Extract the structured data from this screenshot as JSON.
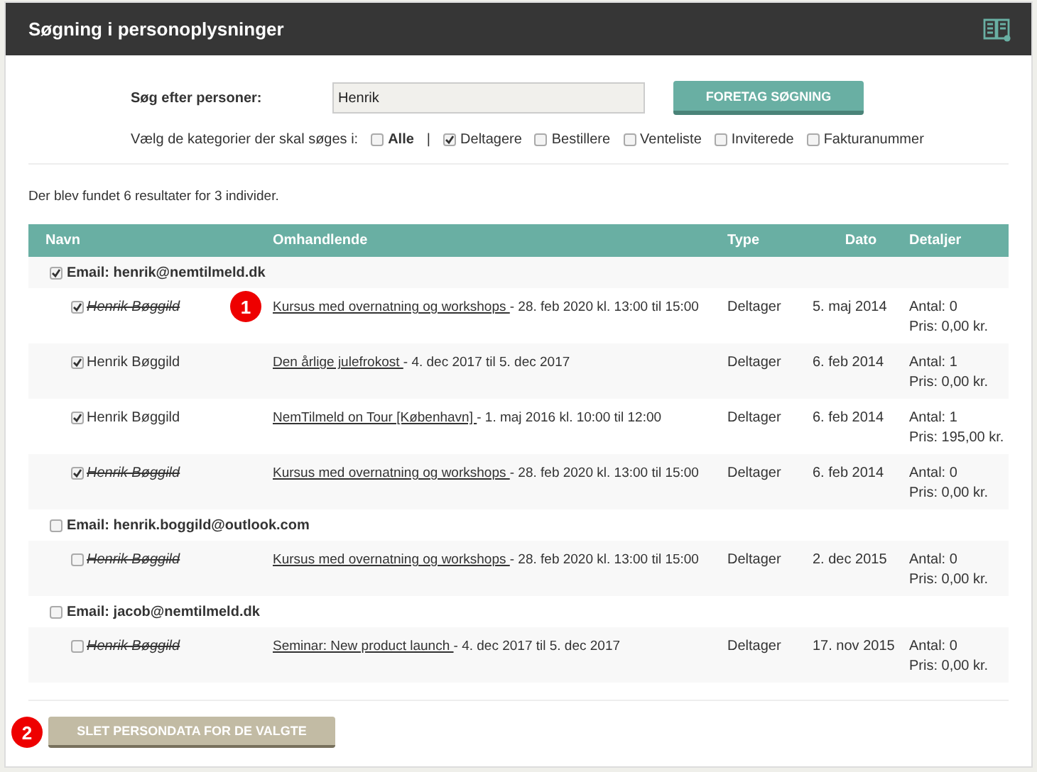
{
  "header": {
    "title": "Søgning i personoplysninger"
  },
  "search": {
    "label": "Søg efter personer:",
    "value": "Henrik",
    "button": "FORETAG SØGNING"
  },
  "categories": {
    "label": "Vælg de kategorier der skal søges i:",
    "separator": "|",
    "items": [
      {
        "label": "Alle",
        "checked": false,
        "bold": true
      },
      {
        "label": "Deltagere",
        "checked": true,
        "bold": false
      },
      {
        "label": "Bestillere",
        "checked": false,
        "bold": false
      },
      {
        "label": "Venteliste",
        "checked": false,
        "bold": false
      },
      {
        "label": "Inviterede",
        "checked": false,
        "bold": false
      },
      {
        "label": "Fakturanummer",
        "checked": false,
        "bold": false
      }
    ]
  },
  "result_text": "Der blev fundet 6 resultater for 3 individer.",
  "table": {
    "columns": [
      "Navn",
      "Omhandlende",
      "Type",
      "Dato",
      "Detaljer"
    ],
    "groups": [
      {
        "label": "Email: henrik@nemtilmeld.dk",
        "checked": true,
        "items": [
          {
            "name": "Henrik Bøggild",
            "checked": true,
            "struck": true,
            "event": "Kursus med overnatning og workshops ",
            "when": "- 28. feb 2020 kl. 13:00 til 15:00",
            "type": "Deltager",
            "date": "5. maj 2014",
            "count": "Antal: 0",
            "price": "Pris: 0,00 kr.",
            "marker": "1"
          },
          {
            "name": "Henrik Bøggild",
            "checked": true,
            "struck": false,
            "event": "Den årlige julefrokost ",
            "when": "- 4. dec 2017 til 5. dec 2017",
            "type": "Deltager",
            "date": "6. feb 2014",
            "count": "Antal: 1",
            "price": "Pris: 0,00 kr."
          },
          {
            "name": "Henrik Bøggild",
            "checked": true,
            "struck": false,
            "event": "NemTilmeld on Tour [København] ",
            "when": "- 1. maj 2016 kl. 10:00 til 12:00",
            "type": "Deltager",
            "date": "6. feb 2014",
            "count": "Antal: 1",
            "price": "Pris: 195,00 kr."
          },
          {
            "name": "Henrik Bøggild",
            "checked": true,
            "struck": true,
            "event": "Kursus med overnatning og workshops ",
            "when": "- 28. feb 2020 kl. 13:00 til 15:00",
            "type": "Deltager",
            "date": "6. feb 2014",
            "count": "Antal: 0",
            "price": "Pris: 0,00 kr."
          }
        ]
      },
      {
        "label": "Email: henrik.boggild@outlook.com",
        "checked": false,
        "items": [
          {
            "name": "Henrik Bøggild",
            "checked": false,
            "struck": true,
            "event": "Kursus med overnatning og workshops ",
            "when": "- 28. feb 2020 kl. 13:00 til 15:00",
            "type": "Deltager",
            "date": "2. dec 2015",
            "count": "Antal: 0",
            "price": "Pris: 0,00 kr."
          }
        ]
      },
      {
        "label": "Email: jacob@nemtilmeld.dk",
        "checked": false,
        "items": [
          {
            "name": "Henrik Bøggild",
            "checked": false,
            "struck": true,
            "event": "Seminar: New product launch ",
            "when": "- 4. dec 2017 til 5. dec 2017",
            "type": "Deltager",
            "date": "17. nov 2015",
            "count": "Antal: 0",
            "price": "Pris: 0,00 kr."
          }
        ]
      }
    ]
  },
  "delete_button": {
    "label": "SLET PERSONDATA FOR DE VALGTE",
    "marker": "2"
  }
}
